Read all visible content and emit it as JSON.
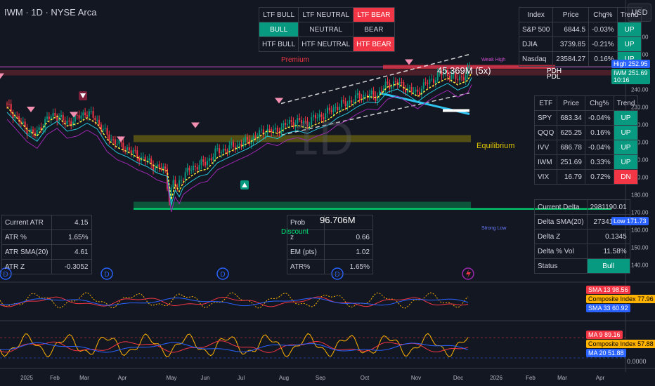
{
  "header": {
    "title": "IWM · 1D · NYSE Arca",
    "currency": "USD"
  },
  "colors": {
    "bull": "#089981",
    "bear": "#f23645",
    "bg": "#131722",
    "premium": "#f23645",
    "equilibrium": "#c8b400",
    "discount": "#00e676"
  },
  "ltf_panel": {
    "rows": [
      [
        "LTF BULL",
        "LTF NEUTRAL",
        "LTF BEAR"
      ],
      [
        "BULL",
        "NEUTRAL",
        "BEAR"
      ],
      [
        "HTF BULL",
        "HTF NEUTRAL",
        "HTF BEAR"
      ]
    ],
    "active": [
      2,
      0,
      2
    ]
  },
  "index_table": {
    "headers": [
      "Index",
      "Price",
      "Chg%",
      "Trend"
    ],
    "rows": [
      [
        "S&P 500",
        "6844.5",
        "-0.03%",
        "UP"
      ],
      [
        "DJIA",
        "3739.85",
        "-0.21%",
        "UP"
      ],
      [
        "Nasdaq",
        "23584.27",
        "0.16%",
        "UP"
      ]
    ]
  },
  "etf_table": {
    "headers": [
      "ETF",
      "Price",
      "Chg%",
      "Trend"
    ],
    "rows": [
      [
        "SPY",
        "683.34",
        "-0.04%",
        "UP"
      ],
      [
        "QQQ",
        "625.25",
        "0.16%",
        "UP"
      ],
      [
        "IVV",
        "686.78",
        "-0.04%",
        "UP"
      ],
      [
        "IWM",
        "251.69",
        "0.33%",
        "UP"
      ],
      [
        "VIX",
        "16.79",
        "0.72%",
        "DN"
      ]
    ]
  },
  "atr_table": {
    "rows": [
      [
        "Current ATR",
        "4.15"
      ],
      [
        "ATR %",
        "1.65%"
      ],
      [
        "ATR SMA(20)",
        "4.61"
      ],
      [
        "ATR Z",
        "-0.3052"
      ]
    ]
  },
  "em_table": {
    "rows": [
      [
        "Prob",
        ""
      ],
      [
        "z",
        "0.66"
      ],
      [
        "EM (pts)",
        "1.02"
      ],
      [
        "ATR%",
        "1.65%"
      ]
    ]
  },
  "delta_table": {
    "rows": [
      [
        "Current Delta",
        "2981190.01"
      ],
      [
        "Delta SMA(20)",
        "2734158.2"
      ],
      [
        "Delta Z",
        "0.1345"
      ],
      [
        "Delta % Vol",
        "11.58%"
      ],
      [
        "Status",
        "Bull"
      ]
    ]
  },
  "annotations": {
    "premium": "Premium",
    "equilibrium": "Equilibrium",
    "discount": "Discount",
    "volume_top": "45.369M (5x)",
    "volume_bottom": "96.706M",
    "pdh": "PDH",
    "pdl": "PDL",
    "watermark": "1D",
    "weak_high": "Weak High",
    "strong_low": "Strong Low"
  },
  "price_tags": {
    "high_label": "High",
    "high_value": "252.95",
    "iwm_label": "IWM",
    "iwm_value": "251.69",
    "iwm_time": "10:16",
    "low_label": "Low",
    "low_value": "171.73"
  },
  "indicator_tags": {
    "sma13_label": "SMA 13",
    "sma13_value": "98.56",
    "ci1_label": "Composite Index",
    "ci1_value": "77.96",
    "sma33_label": "SMA 33",
    "sma33_value": "60.92",
    "ma9_label": "MA 9",
    "ma9_value": "89.16",
    "ci2_label": "Composite Index",
    "ci2_value": "57.88",
    "ma20_label": "MA 20",
    "ma20_value": "51.88",
    "zero": "0.0000"
  },
  "chart_data": {
    "type": "candlestick",
    "symbol": "IWM",
    "timeframe": "1D",
    "x_ticks": [
      "2025",
      "Feb",
      "Mar",
      "Apr",
      "May",
      "Jun",
      "Jul",
      "Aug",
      "Sep",
      "Oct",
      "Nov",
      "Dec",
      "2026",
      "Feb",
      "Mar",
      "Apr"
    ],
    "y_ticks": [
      270,
      260,
      250,
      240,
      230,
      220,
      210,
      200,
      190,
      180,
      170,
      160,
      150,
      140
    ],
    "ylim": [
      135,
      275
    ],
    "closes": [
      [
        0,
        232
      ],
      [
        5,
        225
      ],
      [
        10,
        218
      ],
      [
        15,
        214
      ],
      [
        20,
        222
      ],
      [
        25,
        226
      ],
      [
        30,
        221
      ],
      [
        35,
        223
      ],
      [
        40,
        227
      ],
      [
        45,
        224
      ],
      [
        50,
        215
      ],
      [
        55,
        210
      ],
      [
        60,
        207
      ],
      [
        65,
        203
      ],
      [
        70,
        200
      ],
      [
        75,
        196
      ],
      [
        80,
        194
      ],
      [
        82,
        178
      ],
      [
        84,
        187
      ],
      [
        86,
        184
      ],
      [
        88,
        190
      ],
      [
        92,
        194
      ],
      [
        96,
        197
      ],
      [
        100,
        198
      ],
      [
        105,
        204
      ],
      [
        110,
        206
      ],
      [
        115,
        208
      ],
      [
        120,
        210
      ],
      [
        125,
        213
      ],
      [
        130,
        217
      ],
      [
        135,
        216
      ],
      [
        140,
        220
      ],
      [
        145,
        222
      ],
      [
        150,
        221
      ],
      [
        155,
        224
      ],
      [
        160,
        226
      ],
      [
        165,
        230
      ],
      [
        170,
        232
      ],
      [
        175,
        235
      ],
      [
        180,
        237
      ],
      [
        185,
        236
      ],
      [
        190,
        242
      ],
      [
        195,
        244
      ],
      [
        200,
        241
      ],
      [
        205,
        238
      ],
      [
        210,
        243
      ],
      [
        215,
        247
      ],
      [
        220,
        250
      ],
      [
        225,
        246
      ],
      [
        230,
        248
      ],
      [
        232,
        252
      ]
    ],
    "indicator1_range": [
      0,
      100
    ],
    "indicator2_range": [
      0,
      100
    ],
    "indicator_x_ticks": []
  }
}
